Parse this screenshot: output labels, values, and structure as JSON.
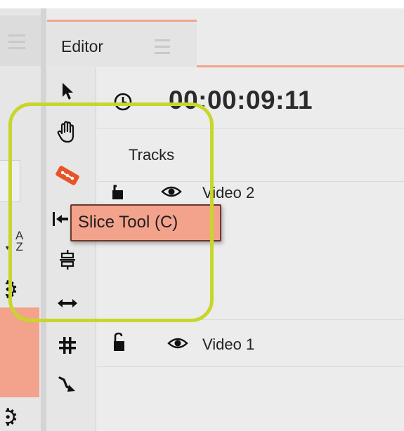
{
  "editor_tab": {
    "label": "Editor"
  },
  "timecode": "00:00:09:11",
  "tracks_header": "Tracks",
  "tracks": [
    {
      "name": "Video 2",
      "locked": true,
      "visible": true
    },
    {
      "name": "Video 1",
      "locked": false,
      "visible": true
    }
  ],
  "tooltip": {
    "text": "Slice Tool (C)"
  },
  "left_panel": {
    "sort_top": "A",
    "sort_bottom": "Z"
  },
  "toolbar": {
    "tools": [
      "select-arrow-icon",
      "hand-icon",
      "razor-blade-icon",
      "snap-to-start-icon",
      "transform-icon",
      "resize-horizontal-icon",
      "timing-icon",
      "curve-arrow-icon"
    ],
    "active_tool": "razor-blade-icon"
  },
  "colors": {
    "accent": "#f3a28c",
    "highlight_ring": "#c8d62c",
    "razor": "#e8542a"
  }
}
